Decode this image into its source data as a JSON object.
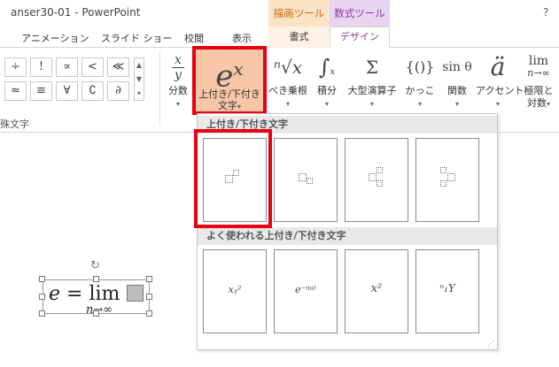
{
  "title_bar": {
    "title": "anser30-01 - PowerPoint",
    "context_tab_drawing": "描画ツール",
    "context_tab_math": "数式ツール",
    "help": "?"
  },
  "tabs": {
    "animation": "アニメーション",
    "slideshow": "スライド ショー",
    "review": "校閲",
    "view": "表示",
    "format": "書式",
    "design": "デザイン"
  },
  "ribbon": {
    "symbols": [
      "÷",
      "!",
      "∝",
      "<",
      "≪",
      "≈",
      "≡",
      "∀",
      "∁",
      "∂"
    ],
    "symbols_group_label": "殊文字",
    "buttons": {
      "fraction": {
        "icon": "x/y",
        "label": "分数"
      },
      "script": {
        "icon": "eˣ",
        "label1": "上付き/下付き",
        "label2": "文字"
      },
      "radical": {
        "icon": "ⁿ√x",
        "label": "べき乗根"
      },
      "integral": {
        "icon": "∫",
        "label": "積分"
      },
      "large_operator": {
        "icon": "Σ",
        "label": "大型演算子"
      },
      "bracket": {
        "icon": "{()}",
        "label": "かっこ"
      },
      "function": {
        "icon": "sin θ",
        "label": "関数"
      },
      "accent": {
        "icon": "ä",
        "label": "アクセント"
      },
      "limit": {
        "icon": "lim",
        "icon_sub": "n→∞",
        "label1": "極限と",
        "label2": "対数"
      }
    }
  },
  "dropdown": {
    "section1_title": "上付き/下付き文字",
    "section2_title": "よく使われる上付き/下付き文字",
    "common_items": [
      "xᵧ²",
      "e⁻ⁱᵚᵗ",
      "x²",
      "ⁿ₁Y"
    ]
  },
  "equation": {
    "main": "e = lim",
    "sub": "n→∞"
  },
  "colors": {
    "highlight": "#e60012",
    "drawing_tools": "#c76b12",
    "math_tools": "#8d3aa5"
  }
}
